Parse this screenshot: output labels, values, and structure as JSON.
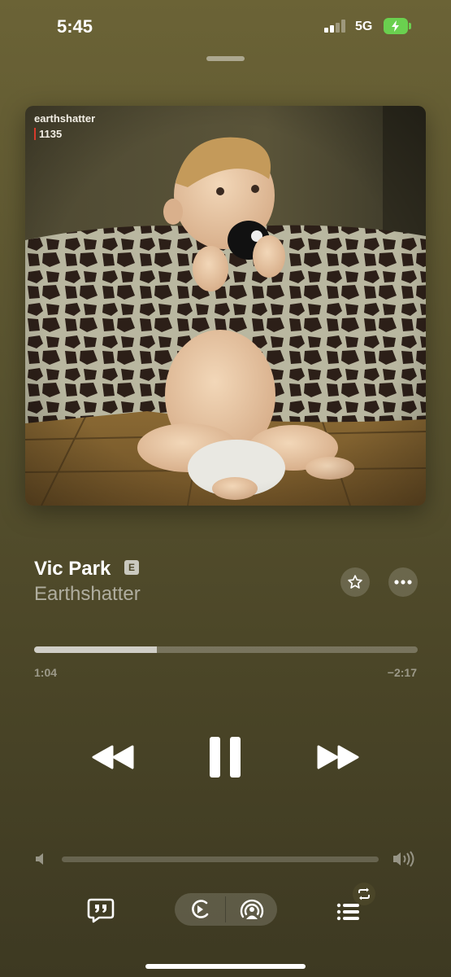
{
  "status_bar": {
    "time": "5:45",
    "network": "5G",
    "battery_color": "#6ad04f"
  },
  "artwork": {
    "brand_text": "earthshatter",
    "number_text": "1135",
    "description_icon": "album-art-image"
  },
  "track": {
    "title": "Vic Park",
    "explicit_badge": "E",
    "artist": "Earthshatter"
  },
  "progress": {
    "elapsed": "1:04",
    "remaining": "−2:17",
    "fraction": 0.32
  },
  "volume": {
    "fraction": 0
  },
  "icons": {
    "favorite": "star-icon",
    "more": "ellipsis-icon",
    "rewind": "rewind-icon",
    "pause": "pause-icon",
    "fast_forward": "fast-forward-icon",
    "lyrics": "lyrics-quote-icon",
    "autoplay": "autoplay-icon",
    "airplay": "airplay-icon",
    "queue": "queue-list-icon",
    "repeat_badge": "repeat-icon"
  },
  "colors": {
    "accent_red": "#d83a2b",
    "background": "#5a5430"
  }
}
